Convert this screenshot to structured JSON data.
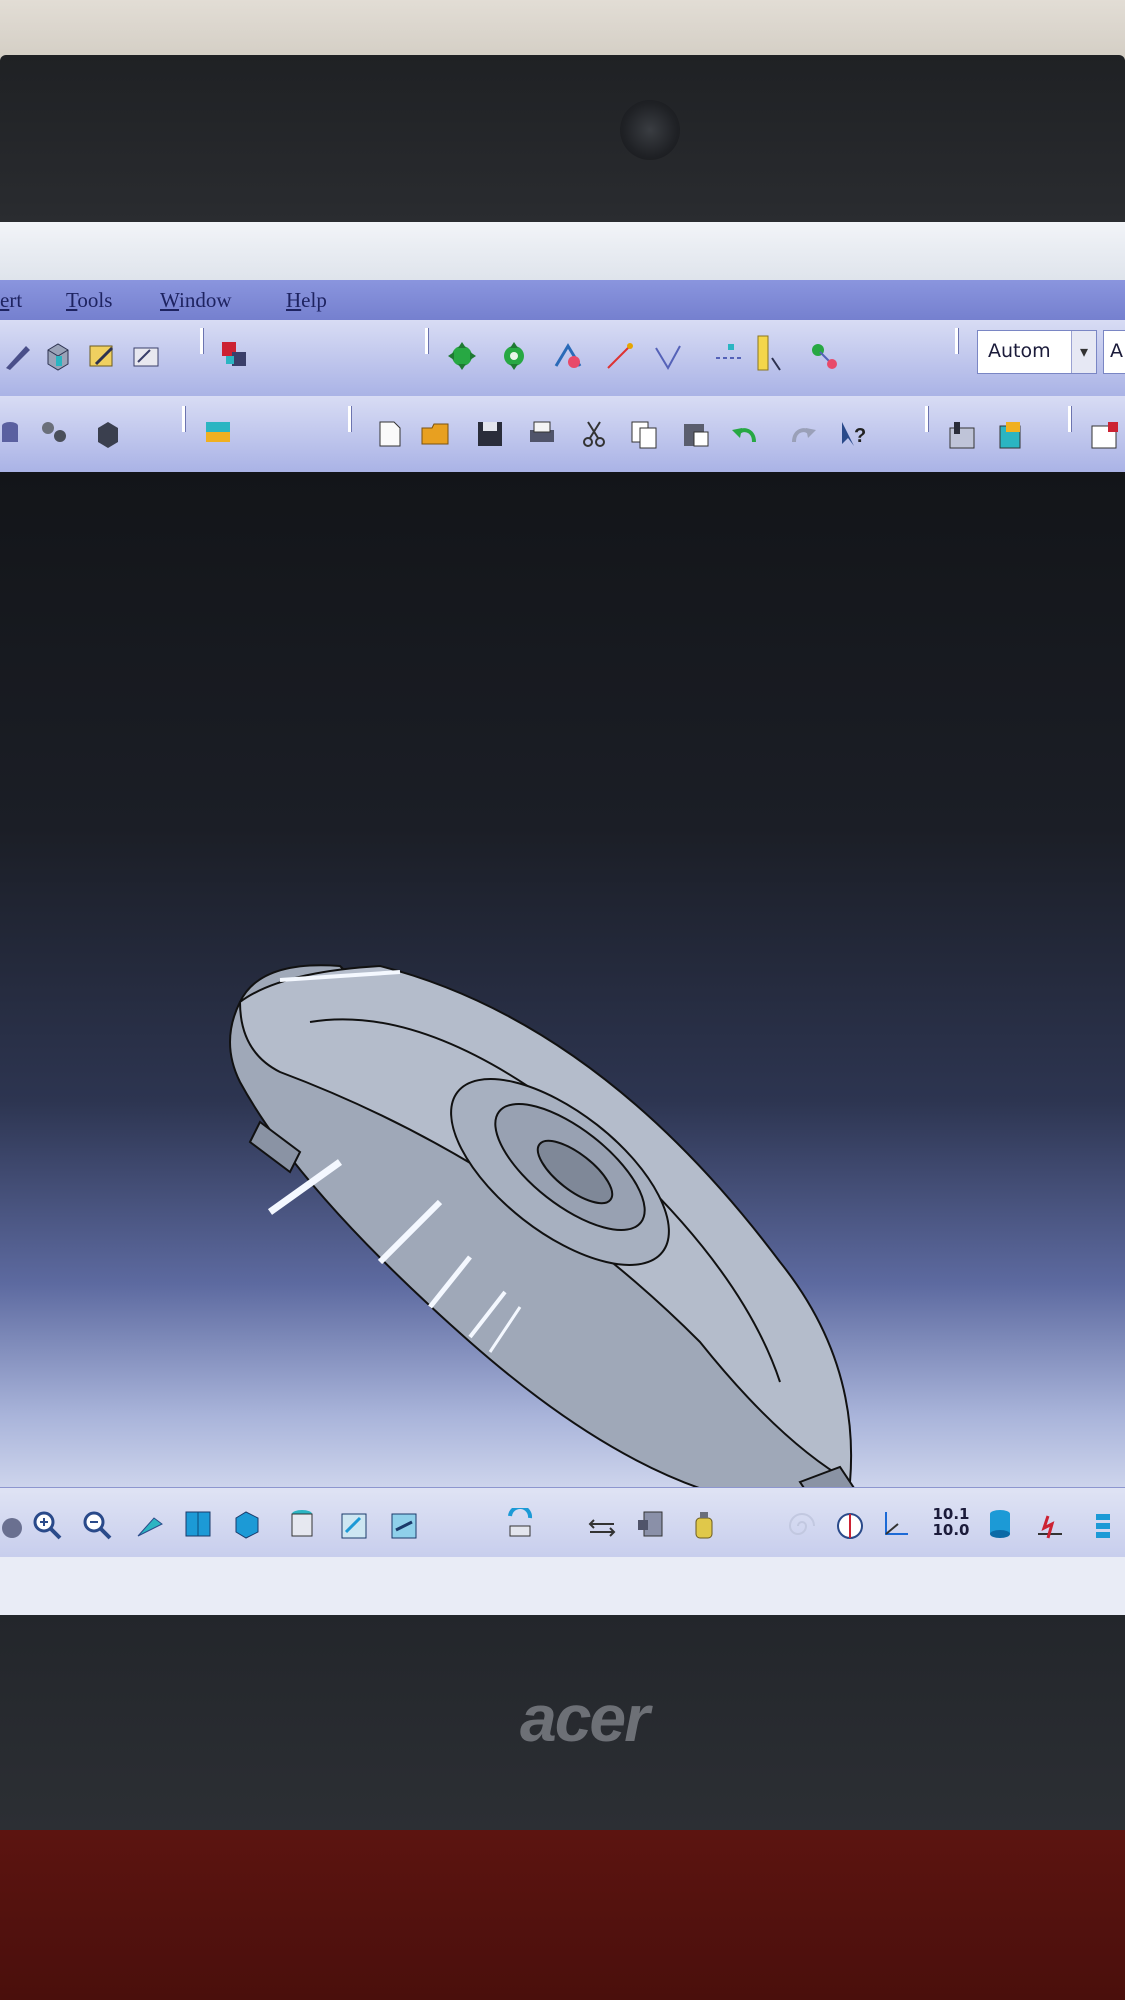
{
  "menu": {
    "items": [
      {
        "label": "ert"
      },
      {
        "label": "Tools"
      },
      {
        "label": "Window"
      },
      {
        "label": "Help"
      }
    ]
  },
  "toolbar": {
    "combo_value": "Autom",
    "combo2_value": "A"
  },
  "bottom_toolbar": {
    "readout_top": "10.1",
    "readout_bottom": "10.0"
  },
  "laptop": {
    "brand": "acer"
  }
}
